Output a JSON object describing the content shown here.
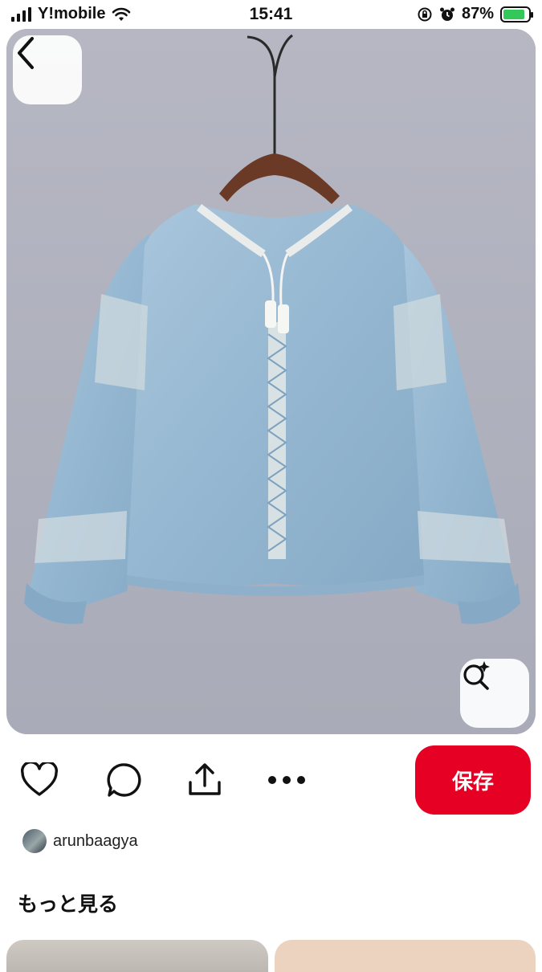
{
  "status_bar": {
    "carrier": "Y!mobile",
    "time": "15:41",
    "battery_percent": "87%",
    "battery_level": 0.87,
    "icons": [
      "signal-icon",
      "wifi-icon",
      "orientation-lock-icon",
      "alarm-icon",
      "battery-charging-icon"
    ]
  },
  "pin": {
    "image_subject": "light-blue-embroidered-denim-blouse-on-hanger",
    "back_icon": "chevron-left-icon",
    "visual_search_icon": "sparkle-search-icon"
  },
  "actions": {
    "icons": [
      "heart-icon",
      "comment-icon",
      "share-icon",
      "more-icon"
    ],
    "save_label": "保存",
    "save_color": "#e60023"
  },
  "author": {
    "username": "arunbaagya"
  },
  "more": {
    "title": "もっと見る"
  }
}
